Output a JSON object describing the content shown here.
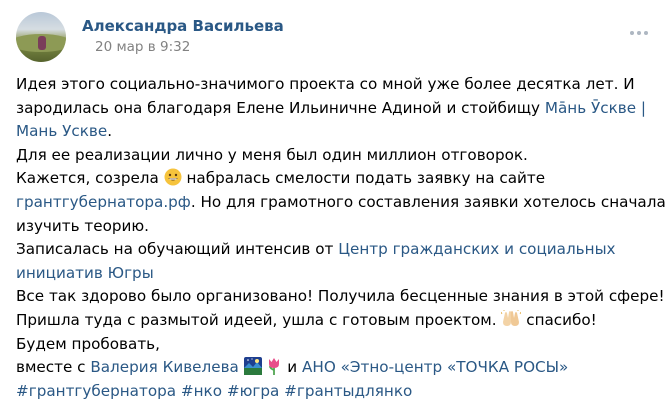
{
  "post": {
    "author": "Александра Васильева",
    "date": "20 мар в 9:32",
    "more_icon": "ellipsis-icon",
    "lines": [
      {
        "t1": "Идея этого социально-значимого проекта со мной уже более десятка лет. И"
      },
      {
        "t1": "зародилась она благодаря Елене Ильиничне Адиной и стойбищу ",
        "link1": "Мāнь Ӯсквe |"
      },
      {
        "link1": "Мань Ускве",
        "t2": "."
      },
      {
        "t1": "Для ее реализации лично у меня был один миллион отговорок."
      },
      {
        "t1": "Кажется, созрела ",
        "emoji": "grinning-face-emoji",
        "t2": " набралась смелости подать заявку на сайте"
      },
      {
        "link1": "грантгубернатора.рф",
        "t2": ". Но для грамотного составления заявки хотелось сначала"
      },
      {
        "t1": "изучить теорию."
      },
      {
        "t1": "Записалась на обучающий интенсив от ",
        "link1": "Центр гражданских и социальных"
      },
      {
        "link1": "инициатив Югры"
      },
      {
        "t1": "Все так здорово было организовано! Получила бесценные знания в этой сфере!"
      },
      {
        "t1": "Пришла туда с размытой идеей, ушла с готовым проектом. ",
        "emoji": "raising-hands-emoji",
        "t2": " спасибо!"
      },
      {
        "t1": "Будем пробовать,"
      },
      {
        "t1": "вместе с ",
        "link1": "Валерия Кивелева",
        "emoji": "night-sky-emoji",
        "emoji2": "tulip-emoji",
        "t2": " и ",
        "link2": "АНО «Этно-центр «ТОЧКА РОСЫ»"
      },
      {
        "hashtags": [
          "#грантгубернатора",
          "#нко",
          "#югра",
          "#грантыдлянко"
        ]
      }
    ]
  },
  "colors": {
    "link": "#2a5885",
    "date": "#828282",
    "text": "#000000"
  }
}
